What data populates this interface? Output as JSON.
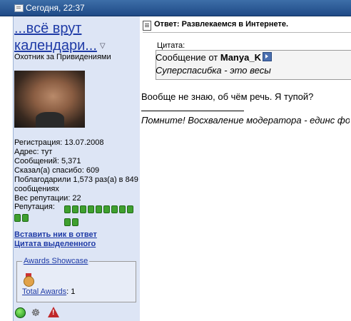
{
  "header": {
    "date": "Сегодня, 22:37"
  },
  "user": {
    "name": "...всё врут календари...",
    "title": "Охотник за Привидениями",
    "info": {
      "registration": "Регистрация: 13.07.2008",
      "address": "Адрес: тут",
      "messages": "Сообщений: 5,371",
      "thanked": "Сказал(а) спасибо: 609",
      "thanked_by": "Поблагодарили 1,573 раз(а) в 849 сообщениях",
      "rep_weight": "Вес репутации: 22",
      "reputation_label": "Репутация:"
    },
    "reputation_blocks": 11
  },
  "links": {
    "insert_nick": "Вставить ник в ответ",
    "quote_selected": "Цитата выделенного"
  },
  "awards": {
    "title": "Awards Showcase",
    "total_label": "Total Awards",
    "total_value": ": 1"
  },
  "post": {
    "title": "Ответ: Развлекаемся в Интернете.",
    "quote_label": "Цитата:",
    "quote_from_prefix": "Сообщение от ",
    "quote_author": "Manya_K",
    "quote_text": "Суперспасибка - это весы",
    "body": "Вообще не знаю, об чём речь. Я тупой?",
    "signature": "Помните! Восхваление модератора - единс форуме!"
  },
  "icons": {
    "online": "online-status-icon",
    "user": "user-profile-icon",
    "report": "report-warning-icon"
  }
}
